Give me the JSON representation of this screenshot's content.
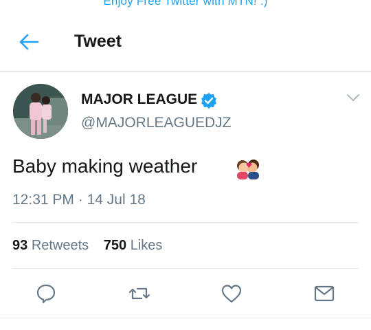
{
  "promo_banner": "Enjoy Free Twitter with MTN! :)",
  "header": {
    "title": "Tweet"
  },
  "author": {
    "name": "MAJOR LEAGUE",
    "handle": "@MAJORLEAGUEDJZ",
    "verified": true
  },
  "tweet": {
    "text": "Baby making weather",
    "emoji": "kiss-emoji",
    "time": "12:31 PM",
    "separator": "·",
    "date": "14 Jul 18"
  },
  "stats": {
    "retweets_count": "93",
    "retweets_label": "Retweets",
    "likes_count": "750",
    "likes_label": "Likes"
  },
  "actions": [
    "reply-icon",
    "retweet-icon",
    "like-icon",
    "share-icon"
  ],
  "colors": {
    "accent": "#1da1f2",
    "text": "#14171a",
    "muted": "#657786",
    "divider": "#e1e8ed"
  }
}
